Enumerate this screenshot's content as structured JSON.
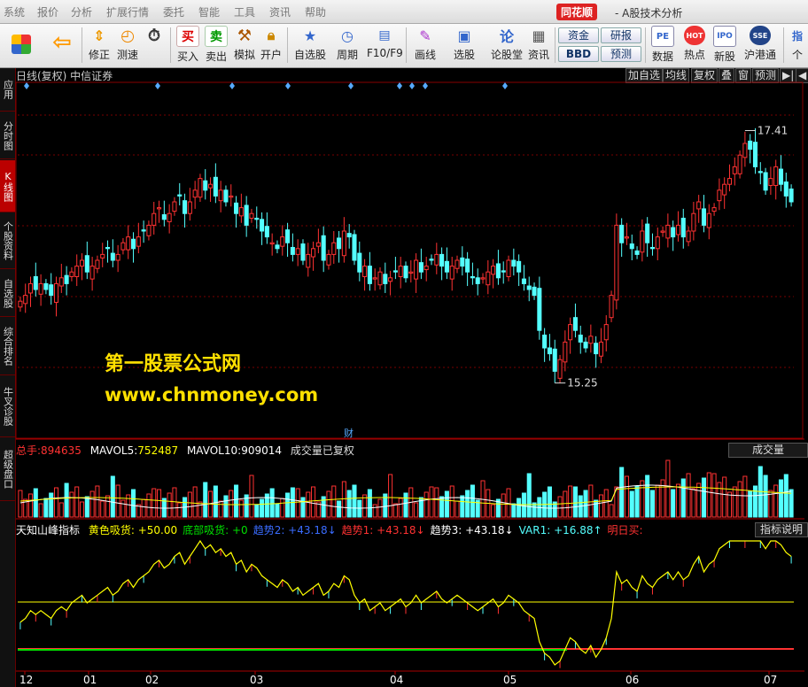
{
  "menu": [
    "系统",
    "报价",
    "分析",
    "扩展行情",
    "委托",
    "智能",
    "工具",
    "资讯",
    "帮助"
  ],
  "brand": {
    "name": "同花顺",
    "subtitle": "- A股技术分析"
  },
  "toolbar": {
    "buttons": [
      {
        "label": "",
        "icon": "grid-icon"
      },
      {
        "label": "",
        "icon": "arrow-left-icon"
      },
      {
        "label": "修正",
        "icon": "arrows-updown-icon"
      },
      {
        "label": "测速",
        "icon": "clock-icon"
      },
      {
        "label": "买入",
        "icon": "buy-icon",
        "glyph": "买"
      },
      {
        "label": "卖出",
        "icon": "sell-icon",
        "glyph": "卖"
      },
      {
        "label": "模拟",
        "icon": "hammer-icon"
      },
      {
        "label": "开户",
        "icon": "lock-icon"
      },
      {
        "label": "自选股",
        "icon": "star-folder-icon"
      },
      {
        "label": "周期",
        "icon": "clock-icon"
      },
      {
        "label": "F10/F9",
        "icon": "f10-icon"
      },
      {
        "label": "画线",
        "icon": "pen-icon"
      },
      {
        "label": "选股",
        "icon": "select-icon"
      },
      {
        "label": "论股堂",
        "icon": "lun-icon",
        "glyph": "论"
      },
      {
        "label": "资讯",
        "icon": "doc-icon"
      },
      {
        "label": "数据",
        "icon": "pe-icon",
        "glyph": "PE"
      },
      {
        "label": "热点",
        "icon": "hot-icon",
        "glyph": "HOT"
      },
      {
        "label": "新股",
        "icon": "ipo-icon",
        "glyph": "IPO"
      },
      {
        "label": "沪港通",
        "icon": "sse-icon",
        "glyph": "SSE"
      },
      {
        "label": "指",
        "icon": "more-icon"
      }
    ],
    "mini_buttons": [
      "资金",
      "研报",
      "BBD",
      "预测"
    ],
    "extra_labels": [
      "个"
    ]
  },
  "sidebar": [
    "应用",
    "分时图",
    "K线图",
    "个股资料",
    "自选股",
    "综合排名",
    "牛叉诊股",
    "超级盘口"
  ],
  "chart_header": {
    "title": "日线(复权) 中信证券"
  },
  "right_buttons": [
    "加自选",
    "均线",
    "复权",
    "叠",
    "窗",
    "预测",
    "▶|",
    "◀"
  ],
  "colors": {
    "up": "#ff3232",
    "down": "#54ffff",
    "yellow": "#ffff00",
    "white": "#ffffff",
    "green": "#00e000",
    "blue": "#3a6cff"
  },
  "watermark": {
    "line1": "第一股票公式网",
    "line2": "www.chnmoney.com"
  },
  "volume_bar": {
    "label": "总手:",
    "value": "894635",
    "ma5_label": "MAVOL5:",
    "ma5": "752487",
    "ma10_label": "MAVOL10:",
    "ma10": "909014",
    "note": "成交量已复权",
    "selector": "成交量"
  },
  "indicator_bar": {
    "name": "天知山峰指标",
    "items": [
      {
        "label": "黄色吸货:",
        "value": "+50.00",
        "color": "#ffff00"
      },
      {
        "label": "底部吸货:",
        "value": "+0",
        "color": "#00e000"
      },
      {
        "label": "趋势2:",
        "value": "+43.18",
        "color": "#3a6cff",
        "arrow": "↓"
      },
      {
        "label": "趋势1:",
        "value": "+43.18",
        "color": "#ff3232",
        "arrow": "↓"
      },
      {
        "label": "趋势3:",
        "value": "+43.18",
        "color": "#ffffff",
        "arrow": "↓"
      },
      {
        "label": "VAR1:",
        "value": "+16.88",
        "color": "#54ffff",
        "arrow": "↑"
      },
      {
        "label": "明日买:",
        "value": "",
        "color": "#ff3232"
      }
    ],
    "button": "指标说明"
  },
  "x_axis_months": [
    "12",
    "01",
    "02",
    "03",
    "04",
    "05",
    "06",
    "07"
  ],
  "price_labels": {
    "high": "17.41",
    "low": "15.25",
    "marker": "财"
  },
  "chart_data": {
    "type": "candlestick",
    "price_range": [
      14.8,
      17.8
    ],
    "high_label": 17.41,
    "low_label": 15.25,
    "close_series": [
      15.95,
      16.0,
      16.1,
      16.05,
      16.1,
      16.05,
      16.0,
      16.1,
      16.15,
      16.1,
      16.2,
      16.25,
      16.3,
      16.2,
      16.25,
      16.3,
      16.35,
      16.4,
      16.3,
      16.35,
      16.45,
      16.5,
      16.4,
      16.5,
      16.55,
      16.6,
      16.7,
      16.75,
      16.65,
      16.7,
      16.8,
      16.85,
      16.7,
      16.8,
      16.9,
      17.0,
      16.9,
      16.95,
      16.85,
      16.9,
      16.8,
      16.85,
      16.7,
      16.75,
      16.6,
      16.7,
      16.65,
      16.55,
      16.5,
      16.45,
      16.4,
      16.5,
      16.45,
      16.35,
      16.4,
      16.3,
      16.35,
      16.4,
      16.45,
      16.3,
      16.35,
      16.45,
      16.4,
      16.55,
      16.5,
      16.3,
      16.2,
      16.25,
      16.1,
      16.15,
      16.2,
      16.1,
      16.15,
      16.2,
      16.25,
      16.15,
      16.2,
      16.3,
      16.2,
      16.25,
      16.3,
      16.35,
      16.25,
      16.2,
      16.25,
      16.3,
      16.25,
      16.2,
      16.15,
      16.1,
      16.15,
      16.2,
      16.25,
      16.15,
      16.2,
      16.3,
      16.25,
      16.2,
      16.1,
      16.05,
      16.0,
      15.7,
      15.55,
      15.5,
      15.35,
      15.45,
      15.6,
      15.75,
      15.7,
      15.6,
      15.55,
      15.65,
      15.5,
      15.6,
      15.75,
      16.0,
      16.6,
      16.45,
      16.5,
      16.4,
      16.35,
      16.55,
      16.45,
      16.4,
      16.5,
      16.55,
      16.6,
      16.5,
      16.6,
      16.5,
      16.55,
      16.7,
      16.8,
      16.6,
      16.7,
      16.75,
      16.9,
      16.95,
      17.0,
      17.1,
      17.2,
      17.3,
      17.25,
      17.1,
      17.05,
      16.9,
      17.0,
      17.1,
      16.95,
      16.85,
      16.8
    ]
  }
}
